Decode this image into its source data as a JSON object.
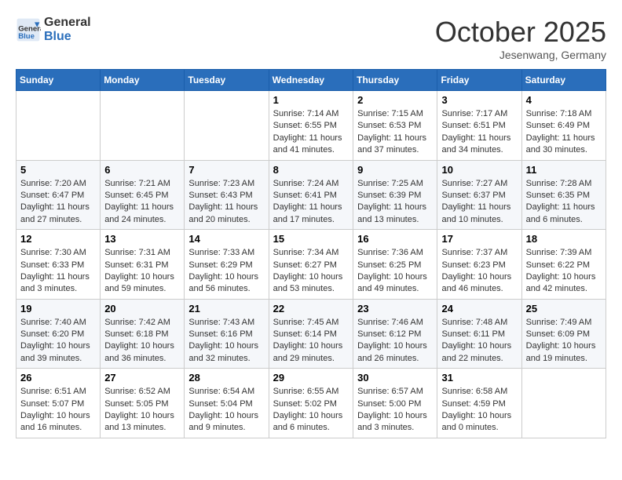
{
  "header": {
    "logo_line1": "General",
    "logo_line2": "Blue",
    "month": "October 2025",
    "location": "Jesenwang, Germany"
  },
  "weekdays": [
    "Sunday",
    "Monday",
    "Tuesday",
    "Wednesday",
    "Thursday",
    "Friday",
    "Saturday"
  ],
  "weeks": [
    [
      {
        "num": "",
        "info": ""
      },
      {
        "num": "",
        "info": ""
      },
      {
        "num": "",
        "info": ""
      },
      {
        "num": "1",
        "info": "Sunrise: 7:14 AM\nSunset: 6:55 PM\nDaylight: 11 hours and 41 minutes."
      },
      {
        "num": "2",
        "info": "Sunrise: 7:15 AM\nSunset: 6:53 PM\nDaylight: 11 hours and 37 minutes."
      },
      {
        "num": "3",
        "info": "Sunrise: 7:17 AM\nSunset: 6:51 PM\nDaylight: 11 hours and 34 minutes."
      },
      {
        "num": "4",
        "info": "Sunrise: 7:18 AM\nSunset: 6:49 PM\nDaylight: 11 hours and 30 minutes."
      }
    ],
    [
      {
        "num": "5",
        "info": "Sunrise: 7:20 AM\nSunset: 6:47 PM\nDaylight: 11 hours and 27 minutes."
      },
      {
        "num": "6",
        "info": "Sunrise: 7:21 AM\nSunset: 6:45 PM\nDaylight: 11 hours and 24 minutes."
      },
      {
        "num": "7",
        "info": "Sunrise: 7:23 AM\nSunset: 6:43 PM\nDaylight: 11 hours and 20 minutes."
      },
      {
        "num": "8",
        "info": "Sunrise: 7:24 AM\nSunset: 6:41 PM\nDaylight: 11 hours and 17 minutes."
      },
      {
        "num": "9",
        "info": "Sunrise: 7:25 AM\nSunset: 6:39 PM\nDaylight: 11 hours and 13 minutes."
      },
      {
        "num": "10",
        "info": "Sunrise: 7:27 AM\nSunset: 6:37 PM\nDaylight: 11 hours and 10 minutes."
      },
      {
        "num": "11",
        "info": "Sunrise: 7:28 AM\nSunset: 6:35 PM\nDaylight: 11 hours and 6 minutes."
      }
    ],
    [
      {
        "num": "12",
        "info": "Sunrise: 7:30 AM\nSunset: 6:33 PM\nDaylight: 11 hours and 3 minutes."
      },
      {
        "num": "13",
        "info": "Sunrise: 7:31 AM\nSunset: 6:31 PM\nDaylight: 10 hours and 59 minutes."
      },
      {
        "num": "14",
        "info": "Sunrise: 7:33 AM\nSunset: 6:29 PM\nDaylight: 10 hours and 56 minutes."
      },
      {
        "num": "15",
        "info": "Sunrise: 7:34 AM\nSunset: 6:27 PM\nDaylight: 10 hours and 53 minutes."
      },
      {
        "num": "16",
        "info": "Sunrise: 7:36 AM\nSunset: 6:25 PM\nDaylight: 10 hours and 49 minutes."
      },
      {
        "num": "17",
        "info": "Sunrise: 7:37 AM\nSunset: 6:23 PM\nDaylight: 10 hours and 46 minutes."
      },
      {
        "num": "18",
        "info": "Sunrise: 7:39 AM\nSunset: 6:22 PM\nDaylight: 10 hours and 42 minutes."
      }
    ],
    [
      {
        "num": "19",
        "info": "Sunrise: 7:40 AM\nSunset: 6:20 PM\nDaylight: 10 hours and 39 minutes."
      },
      {
        "num": "20",
        "info": "Sunrise: 7:42 AM\nSunset: 6:18 PM\nDaylight: 10 hours and 36 minutes."
      },
      {
        "num": "21",
        "info": "Sunrise: 7:43 AM\nSunset: 6:16 PM\nDaylight: 10 hours and 32 minutes."
      },
      {
        "num": "22",
        "info": "Sunrise: 7:45 AM\nSunset: 6:14 PM\nDaylight: 10 hours and 29 minutes."
      },
      {
        "num": "23",
        "info": "Sunrise: 7:46 AM\nSunset: 6:12 PM\nDaylight: 10 hours and 26 minutes."
      },
      {
        "num": "24",
        "info": "Sunrise: 7:48 AM\nSunset: 6:11 PM\nDaylight: 10 hours and 22 minutes."
      },
      {
        "num": "25",
        "info": "Sunrise: 7:49 AM\nSunset: 6:09 PM\nDaylight: 10 hours and 19 minutes."
      }
    ],
    [
      {
        "num": "26",
        "info": "Sunrise: 6:51 AM\nSunset: 5:07 PM\nDaylight: 10 hours and 16 minutes."
      },
      {
        "num": "27",
        "info": "Sunrise: 6:52 AM\nSunset: 5:05 PM\nDaylight: 10 hours and 13 minutes."
      },
      {
        "num": "28",
        "info": "Sunrise: 6:54 AM\nSunset: 5:04 PM\nDaylight: 10 hours and 9 minutes."
      },
      {
        "num": "29",
        "info": "Sunrise: 6:55 AM\nSunset: 5:02 PM\nDaylight: 10 hours and 6 minutes."
      },
      {
        "num": "30",
        "info": "Sunrise: 6:57 AM\nSunset: 5:00 PM\nDaylight: 10 hours and 3 minutes."
      },
      {
        "num": "31",
        "info": "Sunrise: 6:58 AM\nSunset: 4:59 PM\nDaylight: 10 hours and 0 minutes."
      },
      {
        "num": "",
        "info": ""
      }
    ]
  ]
}
